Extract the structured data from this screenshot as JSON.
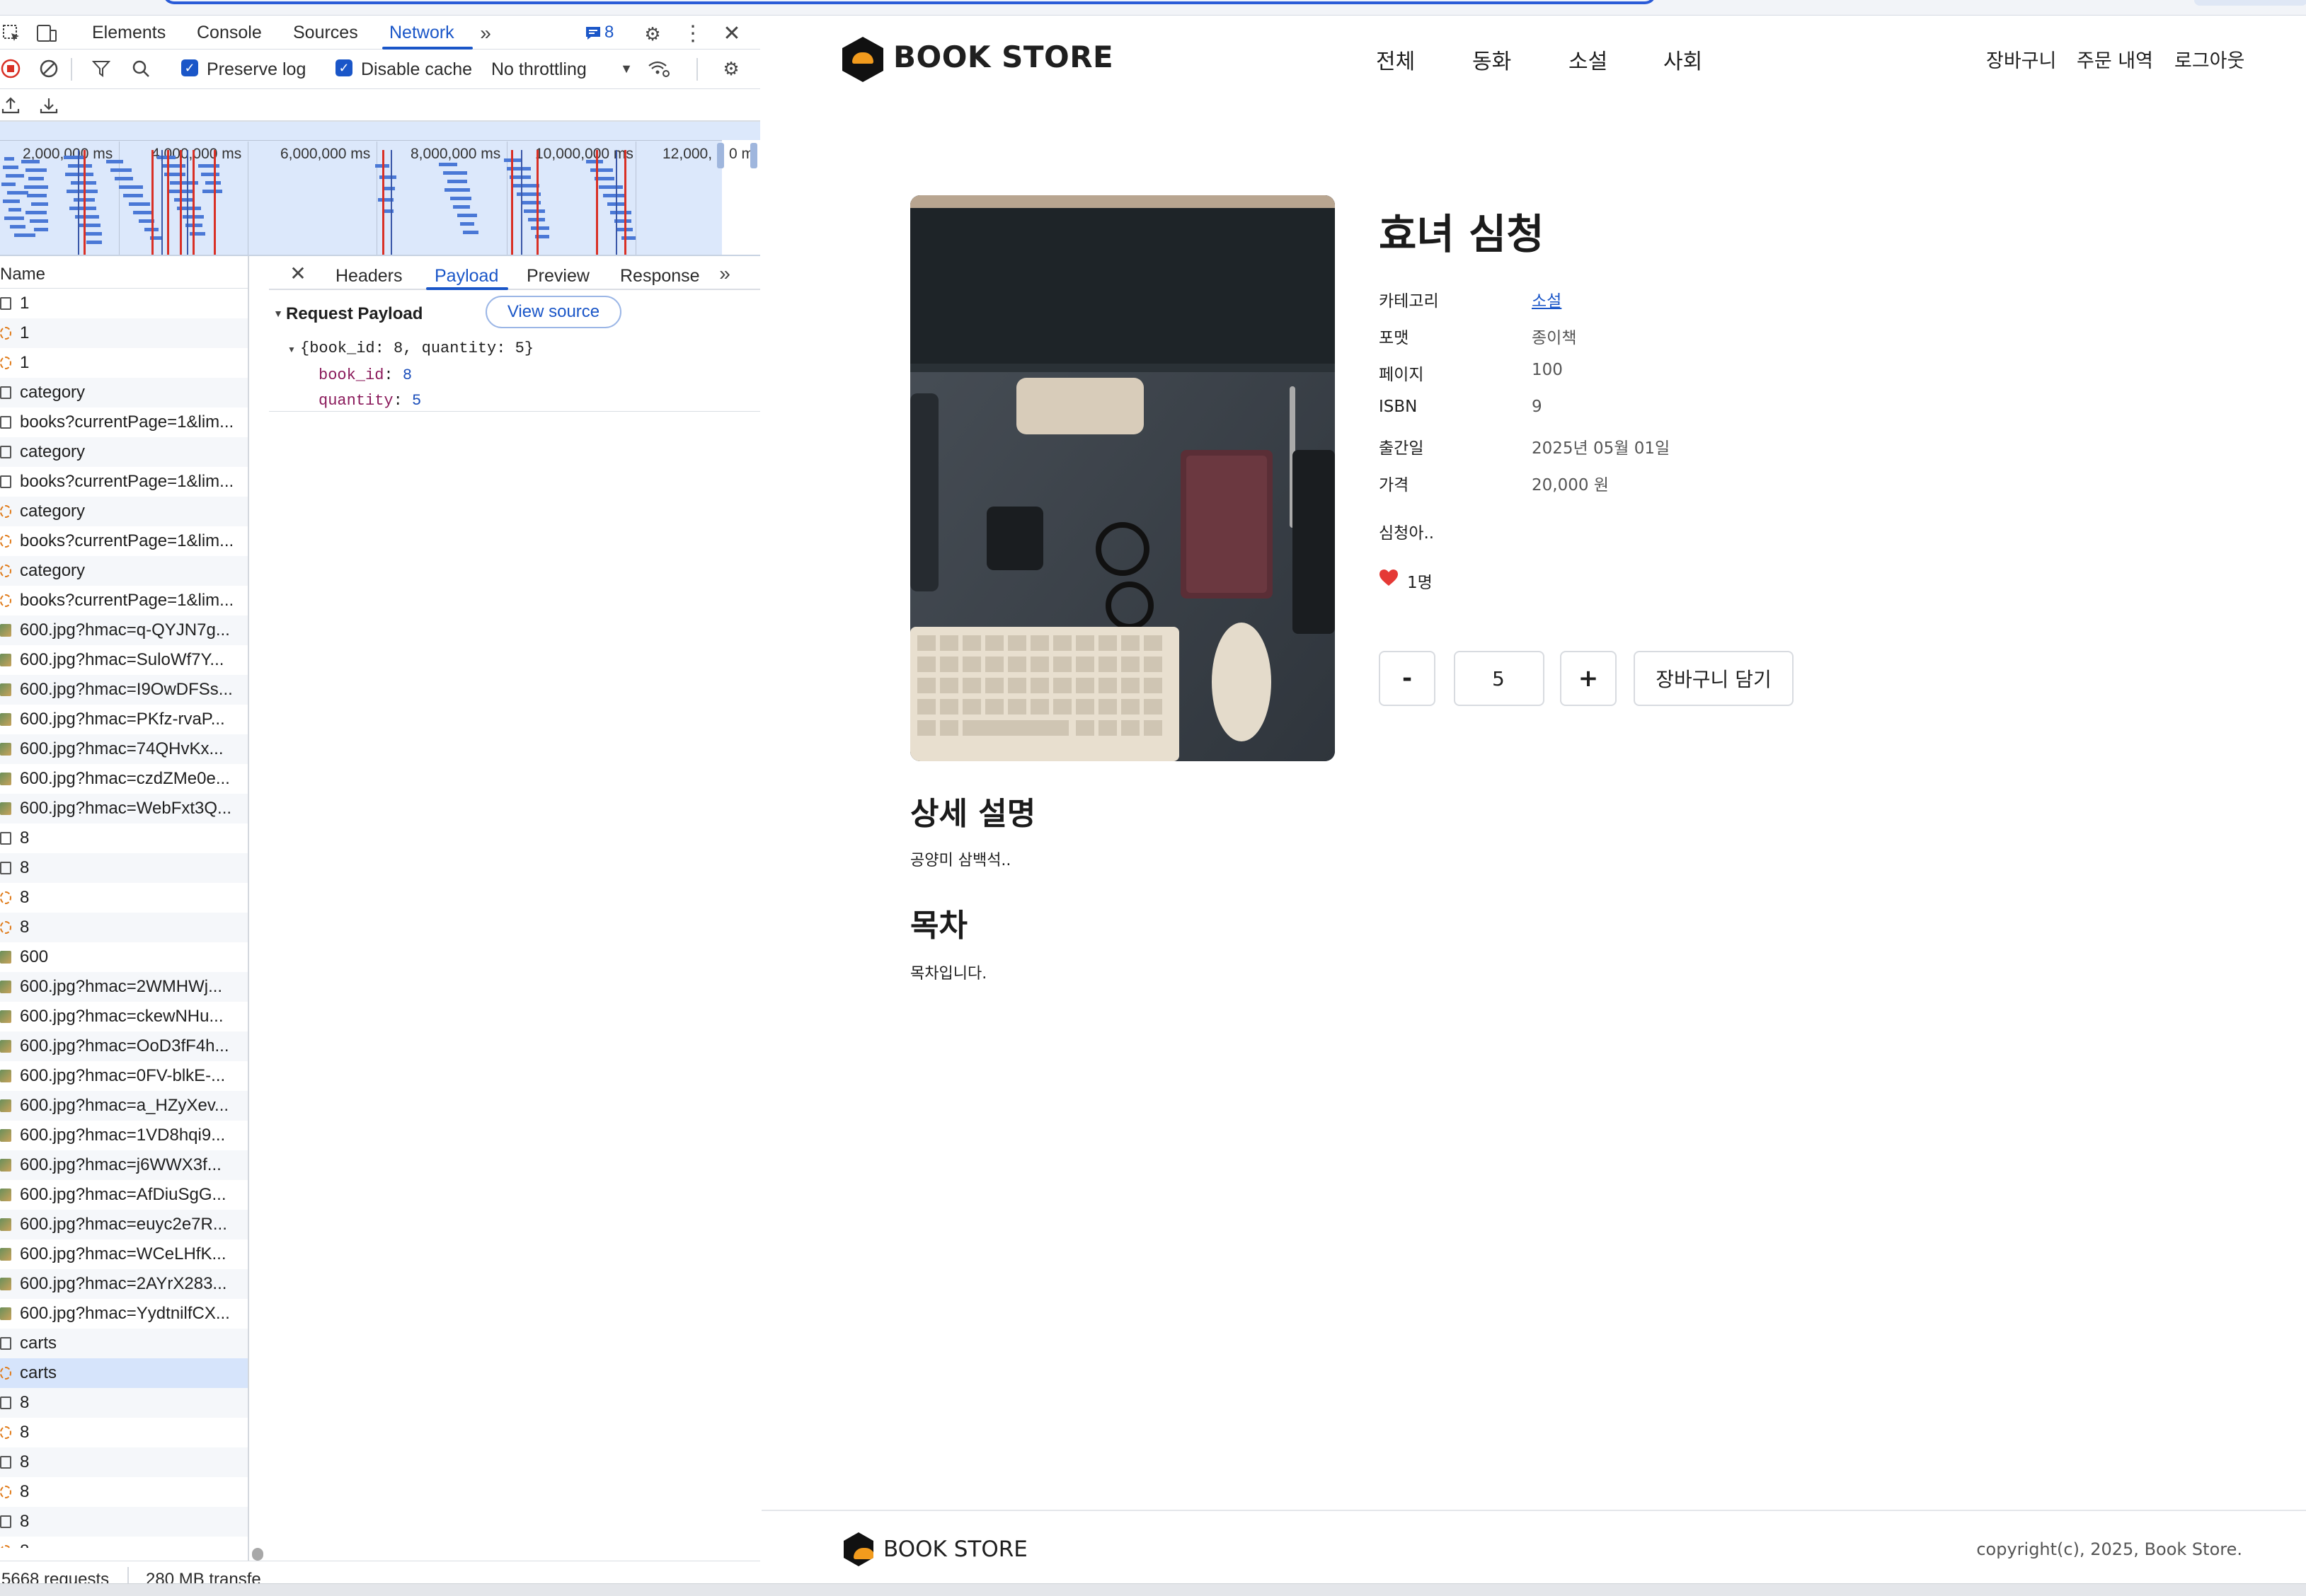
{
  "devtools": {
    "badge_count": "8",
    "tabs": [
      "Elements",
      "Console",
      "Sources",
      "Network"
    ],
    "toolbar": {
      "preserve_log": "Preserve log",
      "disable_cache": "Disable cache",
      "throttling": "No throttling"
    },
    "overview_ticks": [
      "2,000,000 ms",
      "4,000,000 ms",
      "6,000,000 ms",
      "8,000,000 ms",
      "10,000,000 ms",
      "12,000,"
    ],
    "overview_right_label": "0 m",
    "name_header": "Name",
    "requests": [
      {
        "name": "1",
        "type": "doc"
      },
      {
        "name": "1",
        "type": "xhr"
      },
      {
        "name": "1",
        "type": "xhr"
      },
      {
        "name": "category",
        "type": "doc"
      },
      {
        "name": "books?currentPage=1&lim...",
        "type": "doc"
      },
      {
        "name": "category",
        "type": "doc"
      },
      {
        "name": "books?currentPage=1&lim...",
        "type": "doc"
      },
      {
        "name": "category",
        "type": "xhr"
      },
      {
        "name": "books?currentPage=1&lim...",
        "type": "xhr"
      },
      {
        "name": "category",
        "type": "xhr"
      },
      {
        "name": "books?currentPage=1&lim...",
        "type": "xhr"
      },
      {
        "name": "600.jpg?hmac=q-QYJN7g...",
        "type": "img"
      },
      {
        "name": "600.jpg?hmac=SuloWf7Y...",
        "type": "img"
      },
      {
        "name": "600.jpg?hmac=I9OwDFSs...",
        "type": "img"
      },
      {
        "name": "600.jpg?hmac=PKfz-rvaP...",
        "type": "img"
      },
      {
        "name": "600.jpg?hmac=74QHvKx...",
        "type": "img"
      },
      {
        "name": "600.jpg?hmac=czdZMe0e...",
        "type": "img"
      },
      {
        "name": "600.jpg?hmac=WebFxt3Q...",
        "type": "img"
      },
      {
        "name": "8",
        "type": "doc"
      },
      {
        "name": "8",
        "type": "doc"
      },
      {
        "name": "8",
        "type": "xhr"
      },
      {
        "name": "8",
        "type": "xhr"
      },
      {
        "name": "600",
        "type": "img"
      },
      {
        "name": "600.jpg?hmac=2WMHWj...",
        "type": "img"
      },
      {
        "name": "600.jpg?hmac=ckewNHu...",
        "type": "img"
      },
      {
        "name": "600.jpg?hmac=OoD3fF4h...",
        "type": "img"
      },
      {
        "name": "600.jpg?hmac=0FV-blkE-...",
        "type": "img"
      },
      {
        "name": "600.jpg?hmac=a_HZyXev...",
        "type": "img"
      },
      {
        "name": "600.jpg?hmac=1VD8hqi9...",
        "type": "img"
      },
      {
        "name": "600.jpg?hmac=j6WWX3f...",
        "type": "img"
      },
      {
        "name": "600.jpg?hmac=AfDiuSgG...",
        "type": "img"
      },
      {
        "name": "600.jpg?hmac=euyc2e7R...",
        "type": "img"
      },
      {
        "name": "600.jpg?hmac=WCeLHfK...",
        "type": "img"
      },
      {
        "name": "600.jpg?hmac=2AYrX283...",
        "type": "img"
      },
      {
        "name": "600.jpg?hmac=YydtnilfCX...",
        "type": "img"
      },
      {
        "name": "carts",
        "type": "doc"
      },
      {
        "name": "carts",
        "type": "xhr",
        "selected": true
      },
      {
        "name": "8",
        "type": "doc"
      },
      {
        "name": "8",
        "type": "xhr"
      },
      {
        "name": "8",
        "type": "doc"
      },
      {
        "name": "8",
        "type": "xhr"
      },
      {
        "name": "8",
        "type": "doc"
      },
      {
        "name": "8",
        "type": "xhr"
      }
    ],
    "detail_tabs": [
      "Headers",
      "Payload",
      "Preview",
      "Response"
    ],
    "payload": {
      "title": "Request Payload",
      "view_source": "View source",
      "object_summary": "{book_id: 8, quantity: 5}",
      "fields": [
        {
          "key": "book_id",
          "value": "8"
        },
        {
          "key": "quantity",
          "value": "5"
        }
      ]
    },
    "status": {
      "requests": "5668 requests",
      "transferred": "280 MB transfe"
    }
  },
  "site": {
    "title": "BOOK STORE",
    "nav": [
      "전체",
      "동화",
      "소설",
      "사회"
    ],
    "user_menu": [
      "장바구니",
      "주문 내역",
      "로그아웃"
    ],
    "book": {
      "title": "효녀 심청",
      "info": [
        {
          "label": "카테고리",
          "value": "소설",
          "link": true
        },
        {
          "label": "포맷",
          "value": "종이책"
        },
        {
          "label": "페이지",
          "value": "100"
        },
        {
          "label": "ISBN",
          "value": "9"
        },
        {
          "label": "출간일",
          "value": "2025년 05월 01일"
        },
        {
          "label": "가격",
          "value": "20,000 원"
        }
      ],
      "summary": "심청아..",
      "likes": "1명",
      "quantity": "5",
      "minus_label": "-",
      "plus_label": "+",
      "add_to_cart": "장바구니 담기"
    },
    "detail_heading": "상세 설명",
    "detail_text": "공양미 삼백석..",
    "toc_heading": "목차",
    "toc_text": "목차입니다.",
    "footer_title": "BOOK STORE",
    "copyright": "copyright(c), 2025, Book Store."
  },
  "colors": {
    "accent_blue": "#1a56c8",
    "logo_orange": "#f29b1d",
    "heart_red": "#e53935"
  }
}
